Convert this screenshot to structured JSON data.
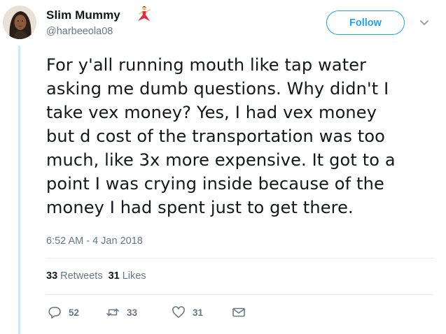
{
  "author": {
    "display_name": "Slim Mummy",
    "handle": "@harbeeola08",
    "emoji_icon": "dancer-emoji-icon"
  },
  "follow_label": "Follow",
  "tweet": {
    "lines": [
      "For y'all running mouth like tap water",
      "asking me dumb questions. Why didn't I",
      "take vex money? Yes, I had vex money",
      "but d cost of the transportation was too",
      "much, like 3x more expensive. It got to a",
      "point I was crying inside because of the",
      "money I had spent just to get there."
    ],
    "timestamp": "6:52 AM - 4 Jan 2018"
  },
  "stats": {
    "retweets_count": "33",
    "retweets_label": "Retweets",
    "likes_count": "31",
    "likes_label": "Likes"
  },
  "actions": {
    "reply_count": "52",
    "retweet_count": "33",
    "like_count": "31"
  },
  "colors": {
    "accent": "#1da1f2",
    "secondary_text": "#657786",
    "thread_line": "#c4ebfb",
    "divider": "#e6ecf0"
  }
}
